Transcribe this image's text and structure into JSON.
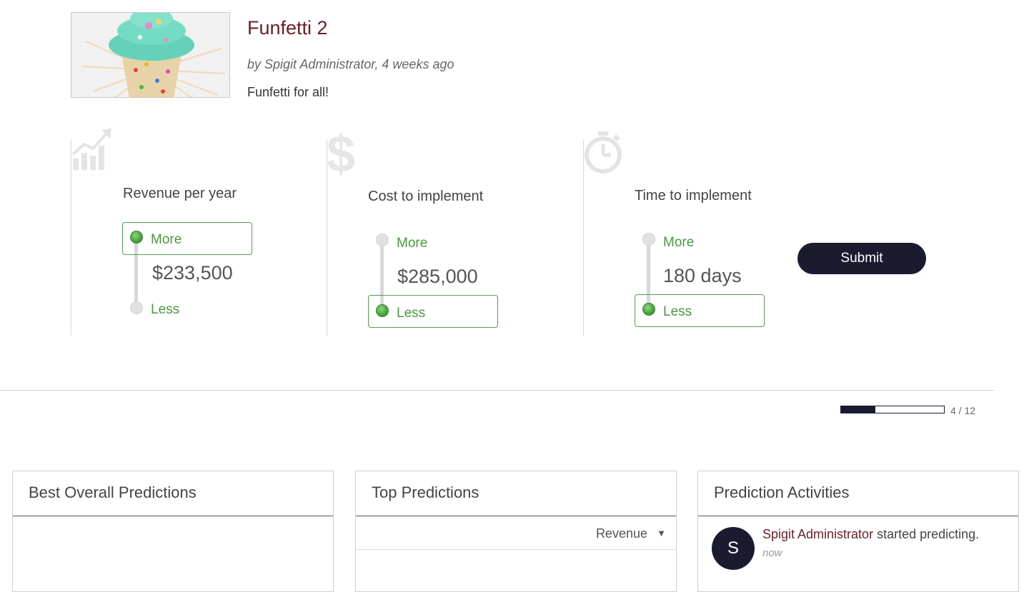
{
  "idea": {
    "title": "Funfetti 2",
    "meta": "by Spigit Administrator, 4 weeks ago",
    "description": "Funfetti for all!",
    "image_alt": "cupcake with teal frosting and sprinkles"
  },
  "metrics": [
    {
      "label": "Revenue per year",
      "icon": "growth-chart-icon",
      "more_label": "More",
      "less_label": "Less",
      "value": "$233,500",
      "selected": "More"
    },
    {
      "label": "Cost to implement",
      "icon": "dollar-icon",
      "more_label": "More",
      "less_label": "Less",
      "value": "$285,000",
      "selected": "Less"
    },
    {
      "label": "Time to implement",
      "icon": "stopwatch-icon",
      "more_label": "More",
      "less_label": "Less",
      "value": "180 days",
      "selected": "Less"
    }
  ],
  "submit_label": "Submit",
  "progress": {
    "current": 4,
    "total": 12,
    "text": "4 / 12"
  },
  "panels": {
    "best": {
      "title": "Best Overall Predictions"
    },
    "top": {
      "title": "Top Predictions",
      "filter": "Revenue"
    },
    "activities": {
      "title": "Prediction Activities",
      "items": [
        {
          "avatar": "S",
          "user": "Spigit Administrator",
          "action": " started predicting.",
          "time": "now"
        }
      ]
    }
  },
  "colors": {
    "accent_dark": "#1b1b30",
    "title_maroon": "#6b1e25",
    "green": "#4ea24a"
  }
}
